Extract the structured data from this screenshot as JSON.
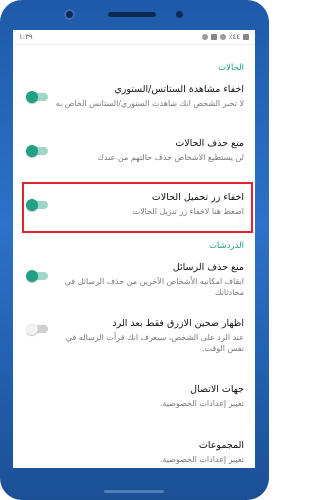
{
  "status_bar": {
    "time": "١:٣٩",
    "signal_text": "٪٤٤"
  },
  "sections": [
    {
      "header": "الحالات",
      "items": [
        {
          "title": "اخفاء مشاهدة الستاتس/الستوري",
          "subtitle": "لا تخبر الشخص انك شاهدت الستوري/الستاتس الخاص به",
          "toggle": "on"
        },
        {
          "title": "منع حذف الحالات",
          "subtitle": "لن يستطيع الاشخاص حذف حالتهم من عندك",
          "toggle": "on"
        },
        {
          "title": "اخفاء زر تحميل الحالات",
          "subtitle": "اضغط هنا لاخفاء زر تنزيل الحالات",
          "toggle": "on"
        }
      ]
    },
    {
      "header": "الدردشات",
      "items": [
        {
          "title": "منع حذف الرسائل",
          "subtitle": "ايقاف امكانيه الأشخاص الآخرين من حذف الرسائل في محادثاتك",
          "toggle": "on"
        },
        {
          "title": "اظهار صحين الازرق فقط بعد الرد",
          "subtitle": "عند الرد على الشخص، سيعرف انك قرأت الرساله في نفس الوقت.",
          "toggle": "off"
        },
        {
          "title": "جهات الاتصال",
          "subtitle": "تغيير إعدادات الخصوصية."
        },
        {
          "title": "المجموعات",
          "subtitle": "تغيير إعدادات الخصوصية."
        }
      ]
    }
  ],
  "colors": {
    "accent": "#20a085",
    "highlight_border": "#e0252f",
    "phone_frame": "#2c72c9"
  }
}
